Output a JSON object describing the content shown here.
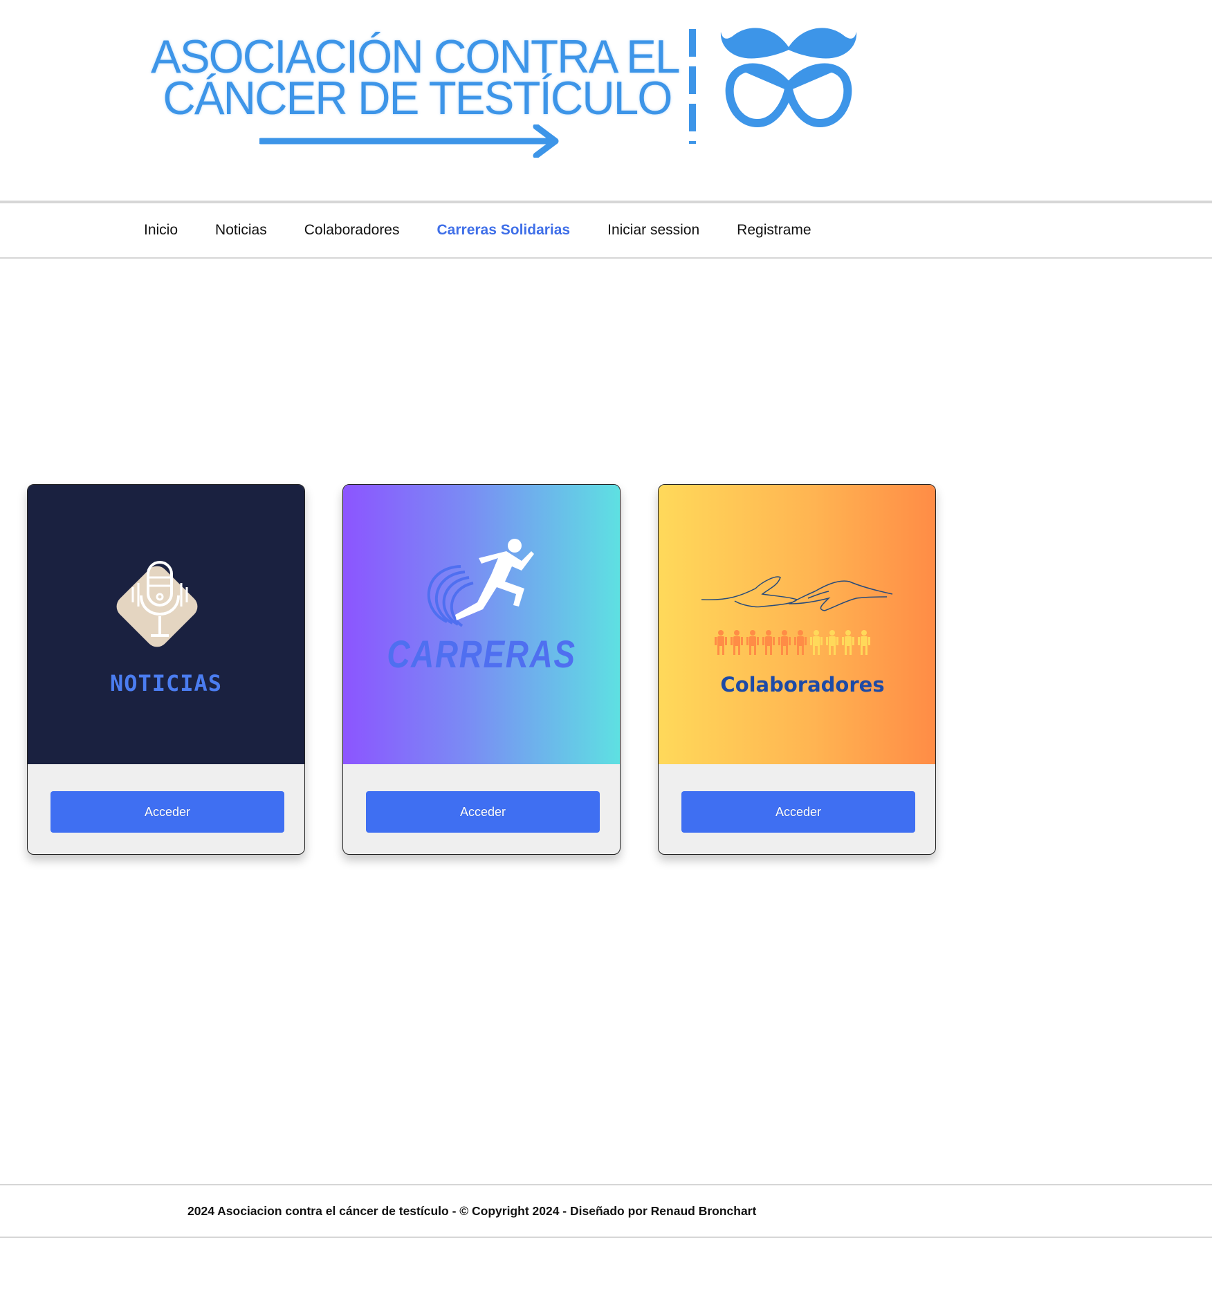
{
  "header": {
    "logo": {
      "line1": "ASOCIACIÓN CONTRA EL",
      "line2": "CÁNCER DE TESTÍCULO",
      "brand_color": "#3d95e8"
    }
  },
  "nav": {
    "items": [
      {
        "label": "Inicio",
        "active": false
      },
      {
        "label": "Noticias",
        "active": false
      },
      {
        "label": "Colaboradores",
        "active": false
      },
      {
        "label": "Carreras Solidarias",
        "active": true
      },
      {
        "label": "Iniciar session",
        "active": false
      },
      {
        "label": "Registrame",
        "active": false
      }
    ],
    "active_color": "#3f6fe8"
  },
  "cards": [
    {
      "image_text": "NOTICIAS",
      "icon": "microphone-icon",
      "button_label": "Acceder"
    },
    {
      "image_text": "CARRERAS",
      "icon": "runner-icon",
      "button_label": "Acceder"
    },
    {
      "image_text": "Colaboradores",
      "icon": "hands-icon",
      "button_label": "Acceder"
    }
  ],
  "colors": {
    "button": "#3f6ff2",
    "noticias_bg": "#1a2140"
  },
  "footer": {
    "text": "2024 Asociacion contra el cáncer de testículo - © Copyright 2024 - Diseñado por Renaud Bronchart"
  }
}
